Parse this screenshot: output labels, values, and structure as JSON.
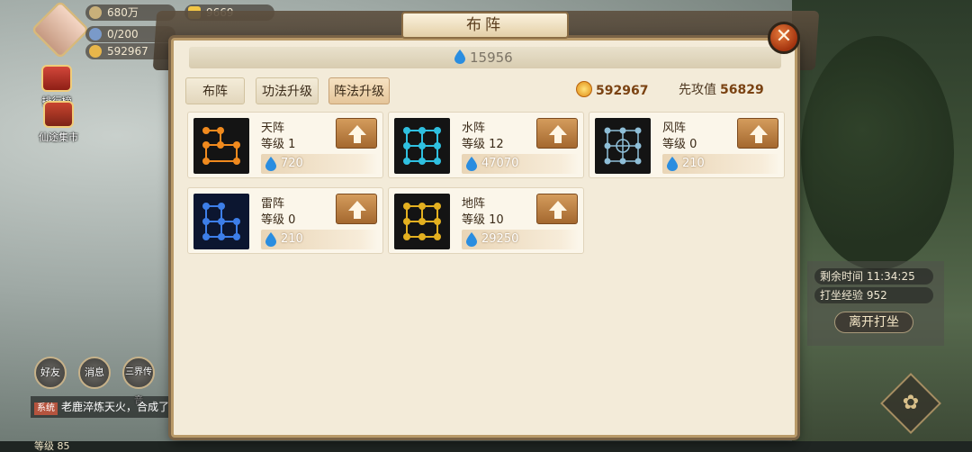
{
  "hud": {
    "silver": "680万",
    "gold": "9669",
    "stamina": "0/200",
    "coins": "592967",
    "rank_label": "排行榜",
    "market_label": "仙途集市"
  },
  "bottom": {
    "friends_label": "好友",
    "messages_label": "消息",
    "world_label": "三界传音",
    "chat_tag": "系统",
    "chat_text": "老鹿淬炼天火，合成了",
    "level_label": "等级 85"
  },
  "meditation": {
    "remaining": "剩余时间 11:34:25",
    "exp": "打坐经验 952",
    "leave_button": "离开打坐"
  },
  "dialog": {
    "title": "布阵",
    "power_value": "15956",
    "tabs": [
      {
        "label": "布阵"
      },
      {
        "label": "功法升级"
      },
      {
        "label": "阵法升级"
      }
    ],
    "currency_value": "592967",
    "initiative_label": "先攻值",
    "initiative_value": "56829",
    "formations": [
      {
        "name": "天阵",
        "level": "等级 1",
        "cost": "720",
        "color": "#f08a1e"
      },
      {
        "name": "水阵",
        "level": "等级 12",
        "cost": "47070",
        "color": "#2fc0e0"
      },
      {
        "name": "风阵",
        "level": "等级 0",
        "cost": "210",
        "color": "#8fbfd8"
      },
      {
        "name": "雷阵",
        "level": "等级 0",
        "cost": "210",
        "color": "#3d7ee8"
      },
      {
        "name": "地阵",
        "level": "等级 10",
        "cost": "29250",
        "color": "#e3b020"
      }
    ]
  },
  "colors": {
    "accent_brown": "#a4682f",
    "water_blue": "#2a8de0",
    "close_orange": "#e4793a"
  }
}
